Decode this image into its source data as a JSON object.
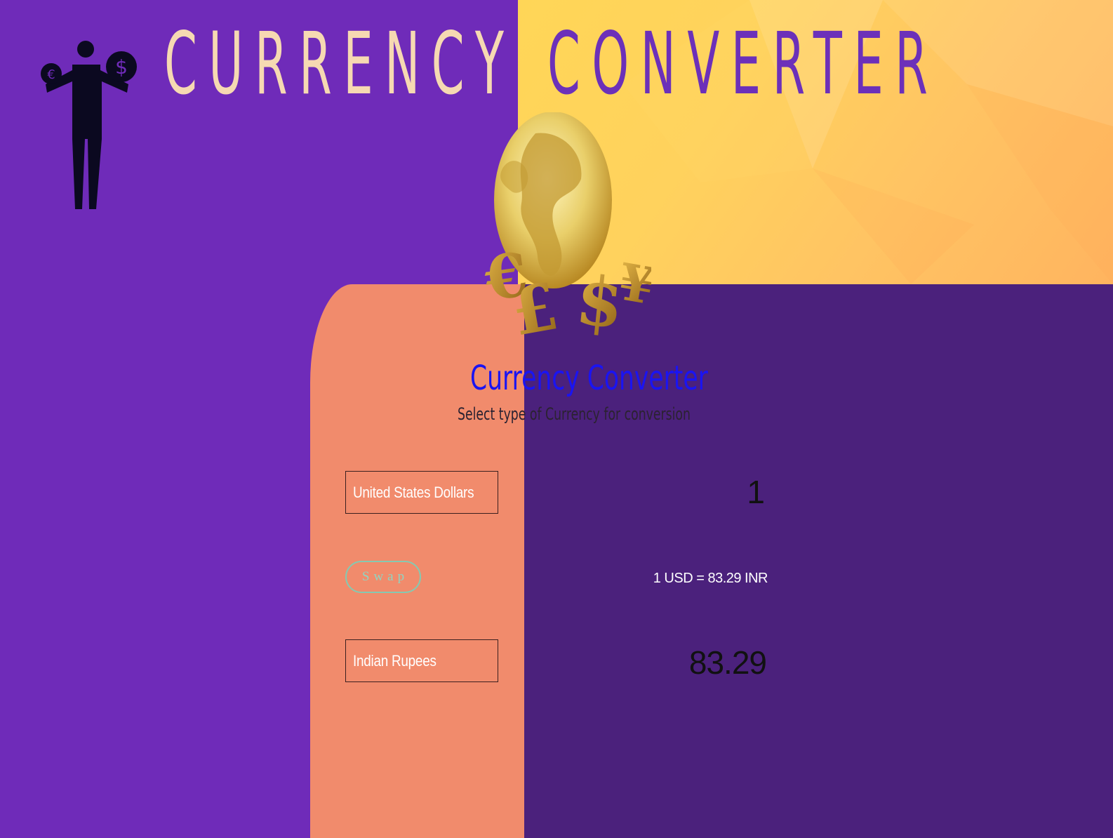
{
  "header": {
    "title_left": "CURRENCY",
    "title_right": "CONVERTER",
    "logo_icon": "person-balancing-currency-icon",
    "hero_art": "globe-with-currency-symbols-icon"
  },
  "converter": {
    "heading": "Currency Converter",
    "subheading": "Select type of Currency for conversion",
    "from_currency": "United States Dollars",
    "to_currency": "Indian Rupees",
    "swap_label": "Swap",
    "amount_value": "1",
    "rate_text": "1 USD = 83.29 INR",
    "result_value": "83.29"
  },
  "colors": {
    "purple_left": "#6f2bb9",
    "purple_dark": "#4b217c",
    "salmon": "#f18b6c",
    "yellow": "#ffd657",
    "heading_blue": "#1a14f2",
    "title_cream": "#f6d9b2",
    "swap_teal": "#8fd5c2"
  }
}
